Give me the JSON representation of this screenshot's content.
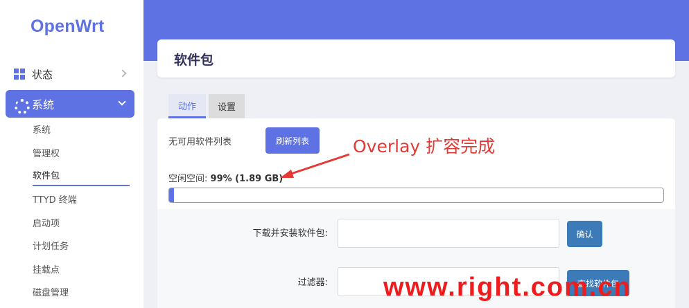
{
  "app": {
    "logo": "OpenWrt"
  },
  "sidebar": {
    "status": {
      "label": "状态"
    },
    "system": {
      "label": "系统"
    },
    "submenu": [
      "系统",
      "管理权",
      "软件包",
      "TTYD 终端",
      "启动项",
      "计划任务",
      "挂载点",
      "磁盘管理"
    ],
    "active_index": 2
  },
  "page": {
    "title": "软件包"
  },
  "tabs": [
    {
      "label": "动作",
      "active": true
    },
    {
      "label": "设置",
      "active": false
    }
  ],
  "actions": {
    "no_list_text": "无可用软件列表",
    "refresh_label": "刷新列表",
    "free_space_label": "空闲空间:",
    "free_space_value": "99% (1.89 GB)",
    "used_fraction": 0.01
  },
  "install": {
    "label": "下载并安装软件包:",
    "value": "",
    "confirm_label": "确认"
  },
  "filter": {
    "label": "过滤器:",
    "value": "",
    "find_label": "查找软件包"
  },
  "annotation": {
    "text": "Overlay 扩容完成",
    "color": "#e53935"
  },
  "watermark": "www.right.com.cn",
  "colors": {
    "accent": "#5e72e4",
    "button_secondary": "#3d7bb8",
    "annotation": "#e53935",
    "watermark": "#ee1c1c"
  }
}
